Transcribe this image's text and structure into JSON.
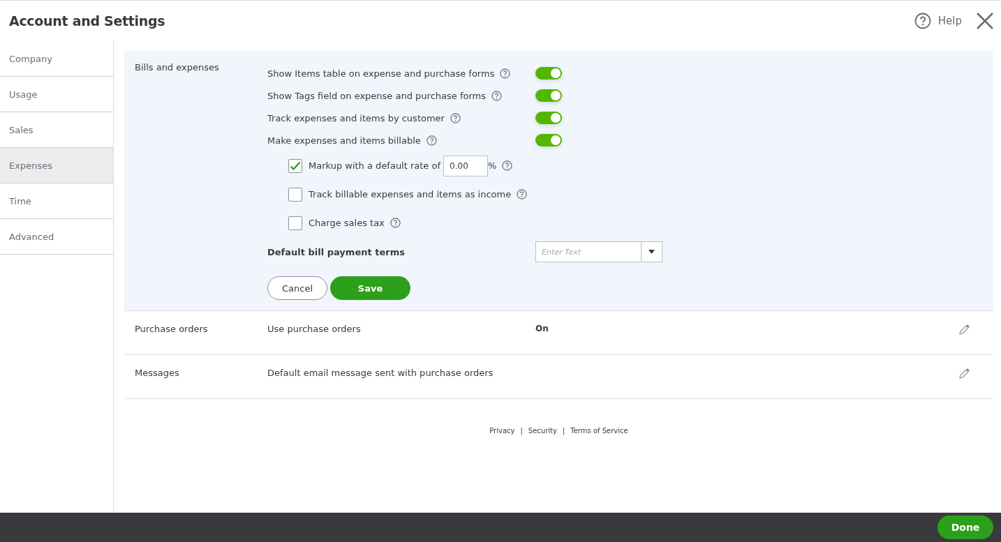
{
  "window": {
    "title": "Account and Settings",
    "help": "Help"
  },
  "sidebar": {
    "items": [
      {
        "label": "Company",
        "selected": false
      },
      {
        "label": "Usage",
        "selected": false
      },
      {
        "label": "Sales",
        "selected": false
      },
      {
        "label": "Expenses",
        "selected": true
      },
      {
        "label": "Time",
        "selected": false
      },
      {
        "label": "Advanced",
        "selected": false
      }
    ]
  },
  "sections": [
    {
      "kind": "editing",
      "title": "Bills and expenses",
      "toggles": [
        {
          "label": "Show Items table on expense and purchase forms",
          "on": true
        },
        {
          "label": "Show Tags field on expense and purchase forms",
          "on": true
        },
        {
          "label": "Track expenses and items by customer",
          "on": true
        },
        {
          "label": "Make expenses and items billable",
          "on": true
        }
      ],
      "options": [
        {
          "label": "Markup with a default rate of",
          "checked": true,
          "value": "0.00",
          "suffix": "%"
        },
        {
          "label": "Track billable expenses and items as income",
          "checked": false
        },
        {
          "label": "Charge sales tax",
          "checked": false
        }
      ],
      "terms": {
        "label": "Default bill payment terms",
        "placeholder": "Enter Text"
      },
      "buttons": {
        "cancel": "Cancel",
        "save": "Save"
      }
    },
    {
      "kind": "summary",
      "title": "Purchase orders",
      "description": "Use purchase orders",
      "value": "On"
    },
    {
      "kind": "summary",
      "title": "Messages",
      "description": "Default email message sent with purchase orders"
    }
  ],
  "footer": {
    "links": [
      "Privacy",
      "Security",
      "Terms of Service"
    ],
    "separators": [
      "|",
      "|"
    ]
  },
  "bottom_bar": {
    "done": "Done"
  }
}
